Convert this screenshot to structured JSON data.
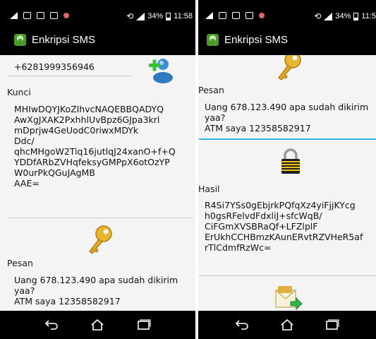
{
  "status_bar": {
    "battery": "34%",
    "time_left": "11:58",
    "time_right": "11:5"
  },
  "app": {
    "title": "Enkripsi SMS"
  },
  "left": {
    "phone_value": "+6281999356946",
    "kunci_label": "Kunci",
    "kunci_value": "MHIwDQYJKoZIhvcNAQEBBQADYQ\nAwXgJXAK2PxhhlUvBpz6GJpa3krl\nmDprjw4GeUodC0riwxMDYk\nDdc/\nqhcMHgoW2Tiq16jutlqJ24xanO+f+Q\nYDDfARbZVHqfeksyGMPpX6otOzYP\nW0urPkQGuJAgMB\nAAE=",
    "pesan_label": "Pesan",
    "pesan_value": "Uang 678.123.490 apa sudah dikirim\nyaa?\nATM saya 12358582917"
  },
  "right": {
    "pesan_label": "Pesan",
    "pesan_value": "Uang 678.123.490 apa sudah dikirim\nyaa?\nATM saya 12358582917",
    "hasil_label": "Hasil",
    "hasil_value": "R4Si7YSs0gEbjrkPQfqXz4yiFjjKYcg\nh0gsRFelvdFdxliJ+sfcWqB/\nCiFGmXVSBRaQf+LFZlplF\nErUkhCCHBmzKAunERvtRZVHeR5af\nrTlCdmfRzWc="
  },
  "icons": {
    "add_contact": "add-contact-icon",
    "key": "key-icon",
    "lock": "padlock-icon",
    "send": "send-message-icon"
  },
  "colors": {
    "focus_underline": "#33b5e5",
    "app_icon": "#4a9b28"
  }
}
